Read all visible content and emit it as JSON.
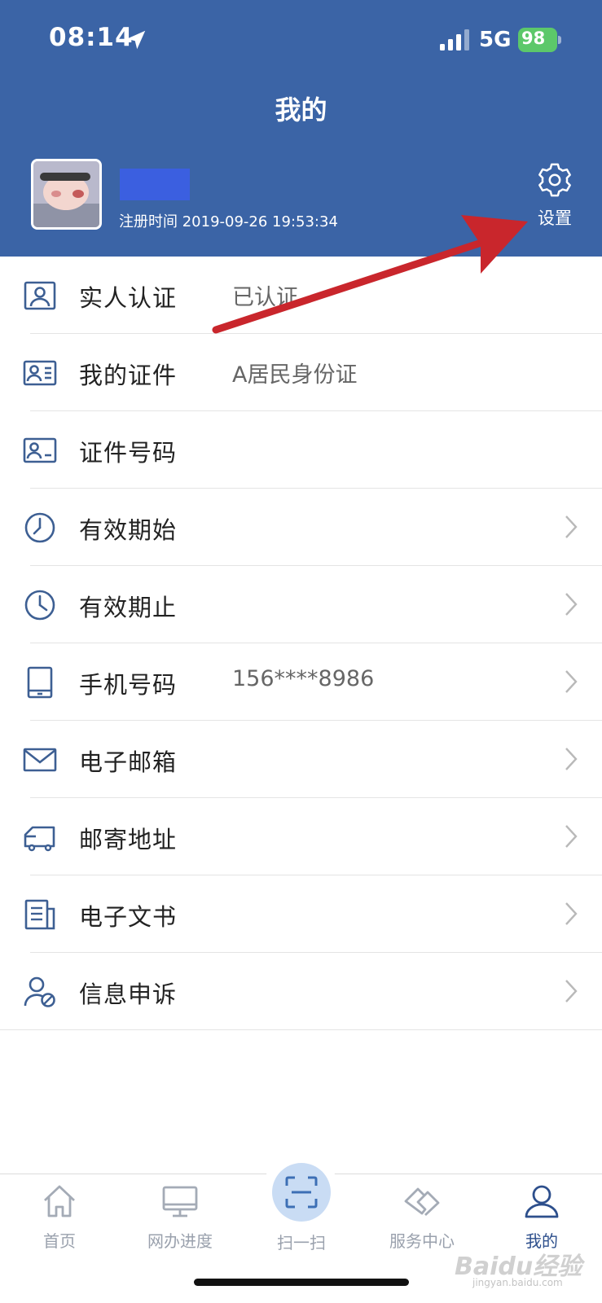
{
  "status_bar": {
    "time": "08:14",
    "network": "5G",
    "battery": "98"
  },
  "header": {
    "title": "我的",
    "registration_time": "注册时间 2019-09-26 19:53:34",
    "settings_label": "设置"
  },
  "list": {
    "items": [
      {
        "label": "实人认证",
        "value": "已认证",
        "icon": "id-card-person-icon"
      },
      {
        "label": "我的证件",
        "value": "A居民身份证",
        "icon": "id-card-lines-icon"
      },
      {
        "label": "证件号码",
        "value": "",
        "icon": "id-card-number-icon"
      },
      {
        "label": "有效期始",
        "value": "",
        "icon": "clock-start-icon"
      },
      {
        "label": "有效期止",
        "value": "",
        "icon": "clock-end-icon"
      },
      {
        "label": "手机号码",
        "value": "156****8986",
        "icon": "tablet-icon"
      },
      {
        "label": "电子邮箱",
        "value": "",
        "icon": "mail-icon"
      },
      {
        "label": "邮寄地址",
        "value": "",
        "icon": "delivery-truck-icon"
      },
      {
        "label": "电子文书",
        "value": "",
        "icon": "document-icon"
      },
      {
        "label": "信息申诉",
        "value": "",
        "icon": "user-appeal-icon"
      }
    ]
  },
  "tabbar": {
    "tabs": [
      {
        "label": "首页"
      },
      {
        "label": "网办进度"
      },
      {
        "label": "扫一扫"
      },
      {
        "label": "服务中心"
      },
      {
        "label": "我的"
      }
    ]
  },
  "watermark": {
    "text": "Baidu经验",
    "sub": "jingyan.baidu.com"
  },
  "colors": {
    "header_bg": "#3b64a6",
    "active_tab": "#2d4f8c",
    "annotation_arrow": "#c9262c"
  }
}
